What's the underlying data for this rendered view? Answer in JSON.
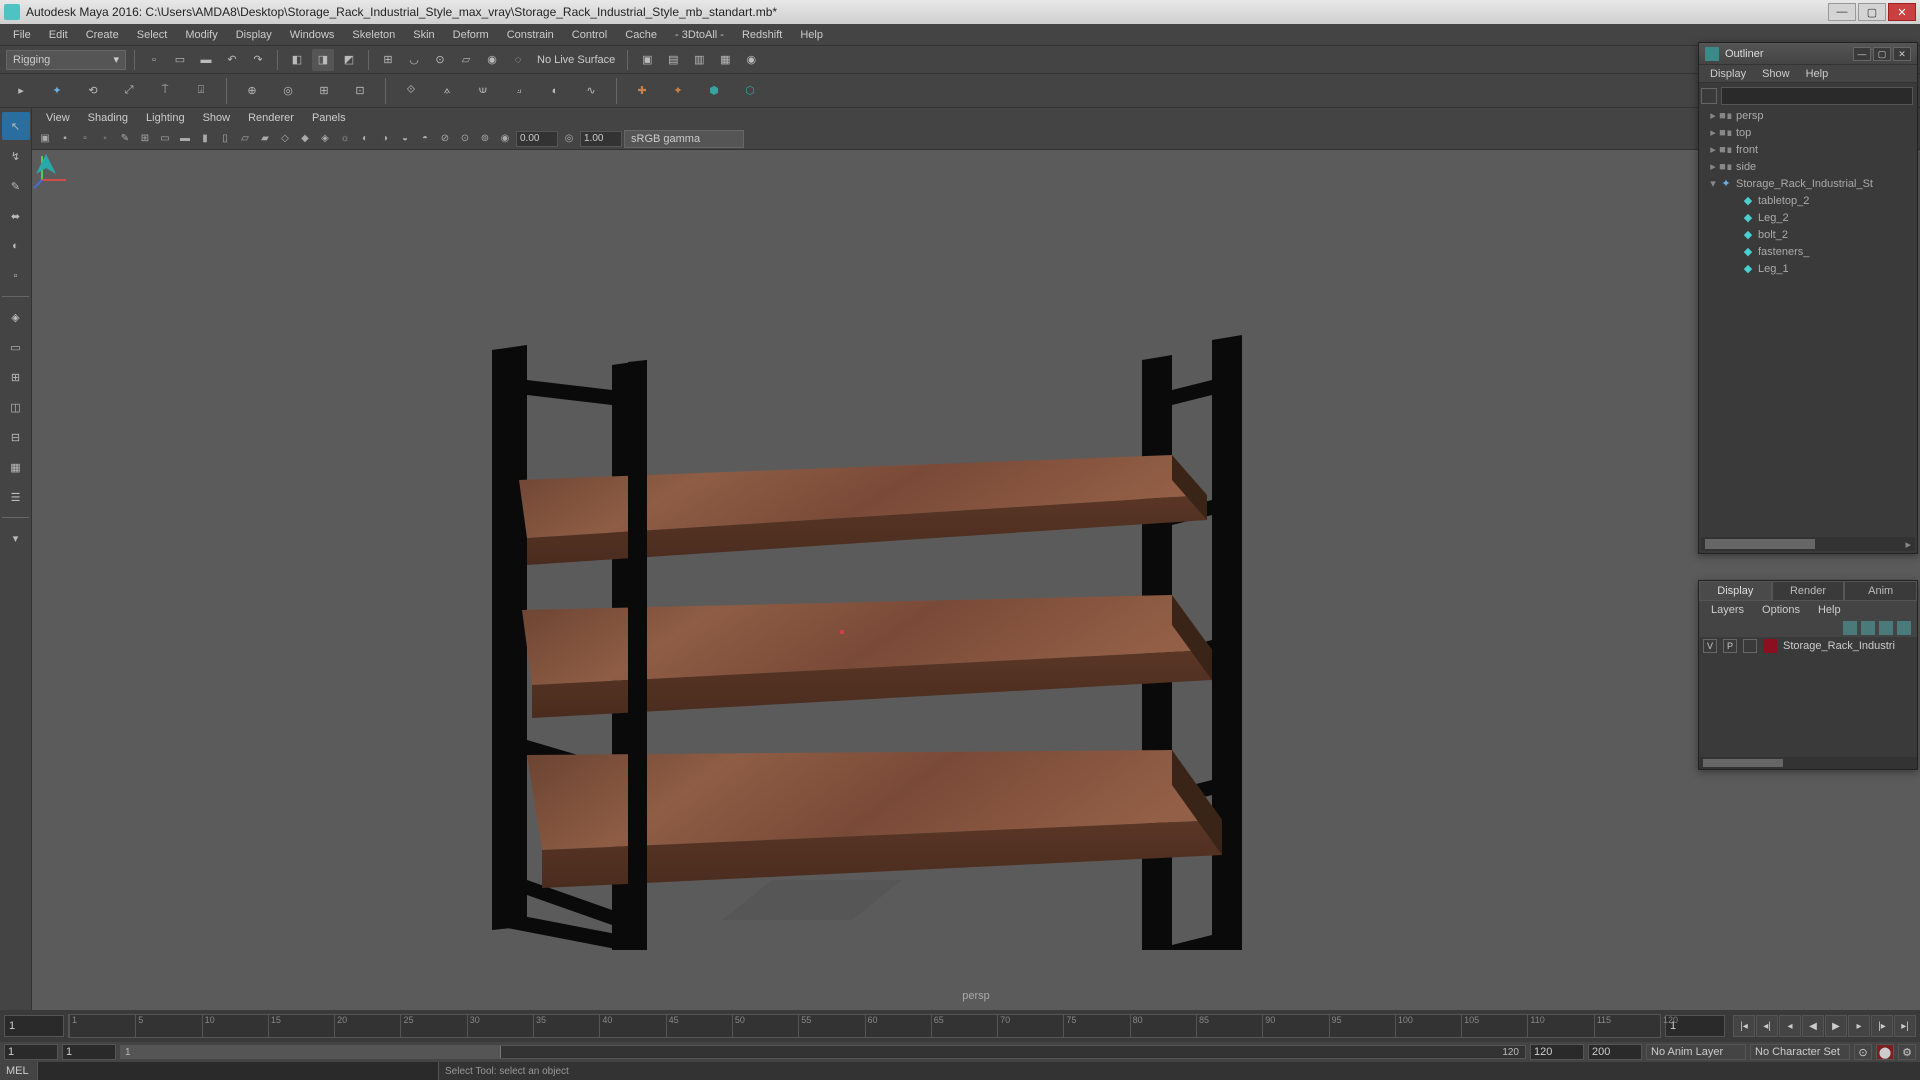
{
  "title": "Autodesk Maya 2016: C:\\Users\\AMDA8\\Desktop\\Storage_Rack_Industrial_Style_max_vray\\Storage_Rack_Industrial_Style_mb_standart.mb*",
  "menubar": [
    "File",
    "Edit",
    "Create",
    "Select",
    "Modify",
    "Display",
    "Windows",
    "Skeleton",
    "Skin",
    "Deform",
    "Constrain",
    "Control",
    "Cache",
    "- 3DtoAll -",
    "Redshift",
    "Help"
  ],
  "shelf_dropdown": "Rigging",
  "no_live_surface": "No Live Surface",
  "viewport_menu": [
    "View",
    "Shading",
    "Lighting",
    "Show",
    "Renderer",
    "Panels"
  ],
  "viewport_inputs": {
    "a": "0.00",
    "b": "1.00"
  },
  "viewport_colorspace": "sRGB gamma",
  "viewport_label": "persp",
  "outliner": {
    "title": "Outliner",
    "menu": [
      "Display",
      "Show",
      "Help"
    ],
    "items": [
      {
        "name": "persp",
        "icon": "cam",
        "indent": 0
      },
      {
        "name": "top",
        "icon": "cam",
        "indent": 0
      },
      {
        "name": "front",
        "icon": "cam",
        "indent": 0
      },
      {
        "name": "side",
        "icon": "cam",
        "indent": 0
      },
      {
        "name": "Storage_Rack_Industrial_St",
        "icon": "grp",
        "indent": 0,
        "expanded": true
      },
      {
        "name": "tabletop_2",
        "icon": "mesh",
        "indent": 1
      },
      {
        "name": "Leg_2",
        "icon": "mesh",
        "indent": 1
      },
      {
        "name": "bolt_2",
        "icon": "mesh",
        "indent": 1
      },
      {
        "name": "fasteners_",
        "icon": "mesh",
        "indent": 1
      },
      {
        "name": "Leg_1",
        "icon": "mesh",
        "indent": 1
      }
    ]
  },
  "layers": {
    "tabs": [
      "Display",
      "Render",
      "Anim"
    ],
    "active_tab": 0,
    "menu": [
      "Layers",
      "Options",
      "Help"
    ],
    "row": {
      "v": "V",
      "p": "P",
      "name": "Storage_Rack_Industri"
    }
  },
  "time": {
    "current": "1",
    "end_display": "1",
    "ticks": [
      1,
      50,
      100,
      150,
      200,
      250,
      300,
      350,
      400,
      450,
      500,
      550,
      600,
      650,
      700,
      750,
      800,
      850,
      900,
      950,
      1000,
      1050,
      1100,
      1150,
      1200
    ],
    "tick_labels": [
      "1",
      "5",
      "10",
      "15",
      "20",
      "25",
      "30",
      "35",
      "40",
      "45",
      "50",
      "55",
      "60",
      "65",
      "70",
      "75",
      "80",
      "85",
      "90",
      "95",
      "100",
      "105",
      "110",
      "115",
      "120"
    ]
  },
  "range": {
    "start": "1",
    "playstart": "1",
    "rangeval": "1",
    "playend": "120",
    "end": "120",
    "total": "200",
    "animlayer": "No Anim Layer",
    "charset": "No Character Set"
  },
  "cmd": {
    "label": "MEL",
    "feedback": "Select Tool: select an object"
  }
}
